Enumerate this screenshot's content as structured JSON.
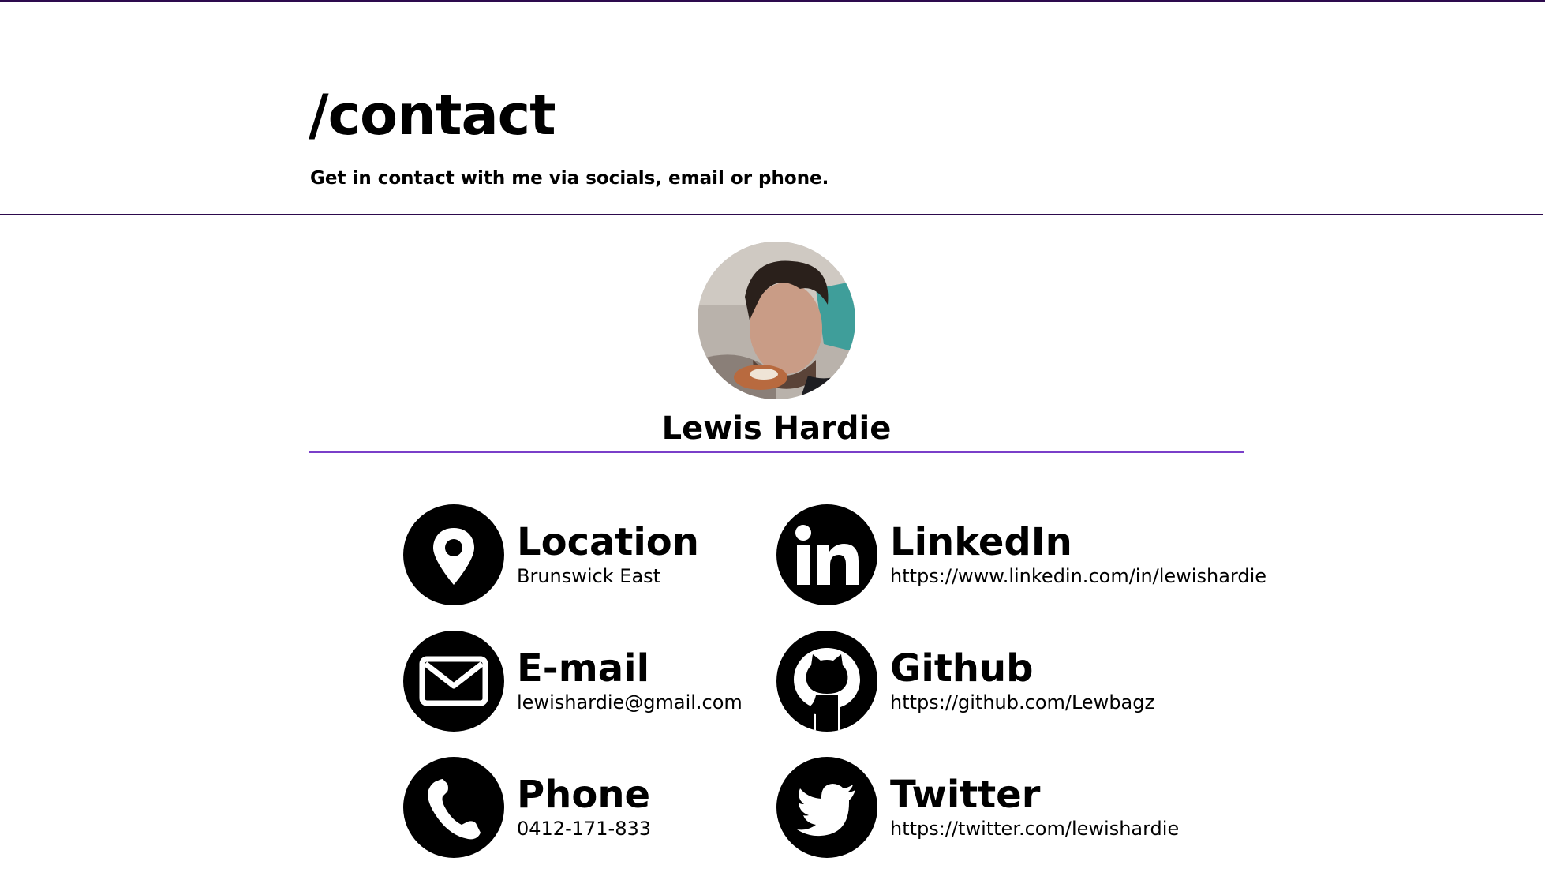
{
  "header": {
    "title": "/contact",
    "subtitle": "Get in contact with me via socials, email or phone."
  },
  "profile": {
    "name": "Lewis Hardie"
  },
  "contacts": {
    "location": {
      "label": "Location",
      "value": "Brunswick East",
      "icon": "map-pin-icon"
    },
    "email": {
      "label": "E-mail",
      "value": "lewishardie@gmail.com",
      "icon": "envelope-icon"
    },
    "phone": {
      "label": "Phone",
      "value": "0412-171-833",
      "icon": "phone-icon"
    },
    "linkedin": {
      "label": "LinkedIn",
      "value": "https://www.linkedin.com/in/lewishardie",
      "icon": "linkedin-icon"
    },
    "github": {
      "label": "Github",
      "value": "https://github.com/Lewbagz",
      "icon": "github-icon"
    },
    "twitter": {
      "label": "Twitter",
      "value": "https://twitter.com/lewishardie",
      "icon": "twitter-icon"
    }
  },
  "colors": {
    "rule": "#2d0a4d",
    "accent": "#7a3fc9",
    "icon_bg": "#000000"
  }
}
